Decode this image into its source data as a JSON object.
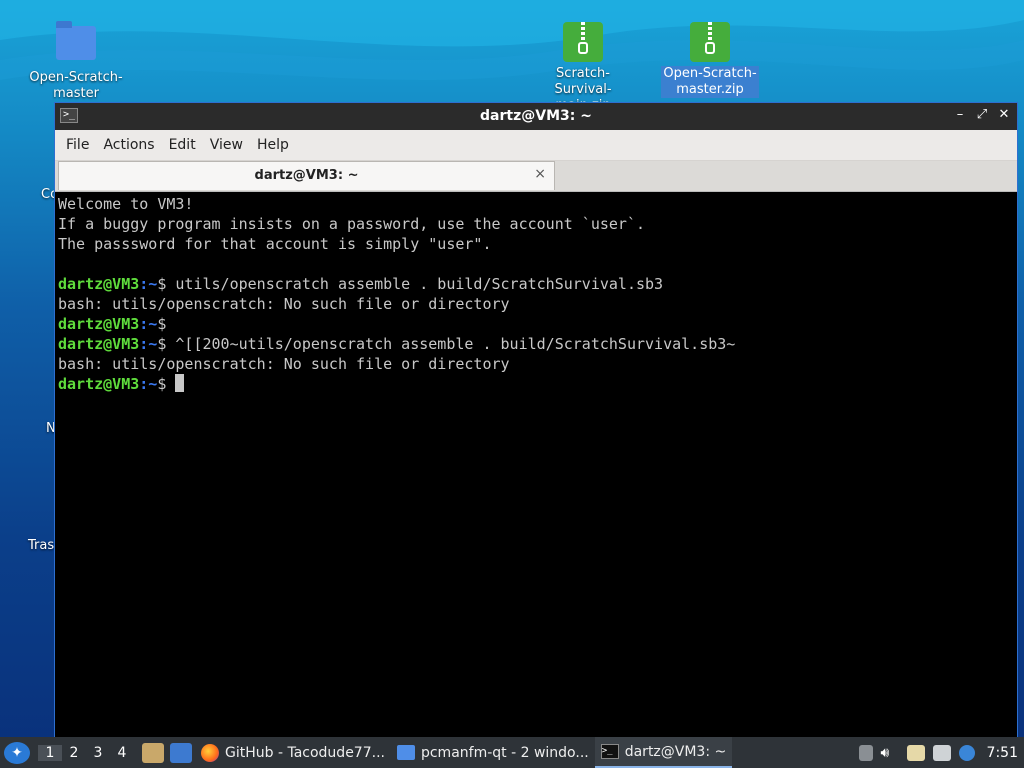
{
  "desktop": {
    "icons": [
      {
        "label": "Open-Scratch-\nmaster",
        "line1": "Open-Scratch-",
        "line2": "master"
      },
      {
        "line1": "Scratch-Survival-",
        "line2": "main.zip"
      },
      {
        "line1": "Open-Scratch-",
        "line2": "master.zip"
      }
    ],
    "side_labels": [
      "Co",
      "N",
      "Tras"
    ]
  },
  "window": {
    "title": "dartz@VM3: ~",
    "icon_glyph": ">_",
    "controls": [
      "–",
      "⤢",
      "✕"
    ],
    "menu": [
      "File",
      "Actions",
      "Edit",
      "View",
      "Help"
    ],
    "tab": {
      "label": "dartz@VM3: ~",
      "close": "×"
    }
  },
  "terminal": {
    "prompt_user": "dartz@VM3",
    "prompt_path": ":~",
    "prompt_sym": "$ ",
    "lines": [
      {
        "type": "text",
        "text": "Welcome to VM3!"
      },
      {
        "type": "text",
        "text": "If a buggy program insists on a password, use the account `user`."
      },
      {
        "type": "text",
        "text": "The passsword for that account is simply \"user\"."
      },
      {
        "type": "text",
        "text": ""
      },
      {
        "type": "cmd",
        "text": "utils/openscratch assemble . build/ScratchSurvival.sb3"
      },
      {
        "type": "text",
        "text": "bash: utils/openscratch: No such file or directory"
      },
      {
        "type": "cmd",
        "text": ""
      },
      {
        "type": "cmd",
        "text": "^[[200~utils/openscratch assemble . build/ScratchSurvival.sb3~"
      },
      {
        "type": "text",
        "text": "bash: utils/openscratch: No such file or directory"
      },
      {
        "type": "cmd",
        "text": "",
        "cursor": true
      }
    ]
  },
  "taskbar": {
    "workspaces": [
      "1",
      "2",
      "3",
      "4"
    ],
    "tasks": [
      {
        "label": "GitHub - Tacodude77..."
      },
      {
        "label": "pcmanfm-qt - 2 windo..."
      },
      {
        "label": "dartz@VM3: ~"
      }
    ],
    "clock": "7:51"
  }
}
